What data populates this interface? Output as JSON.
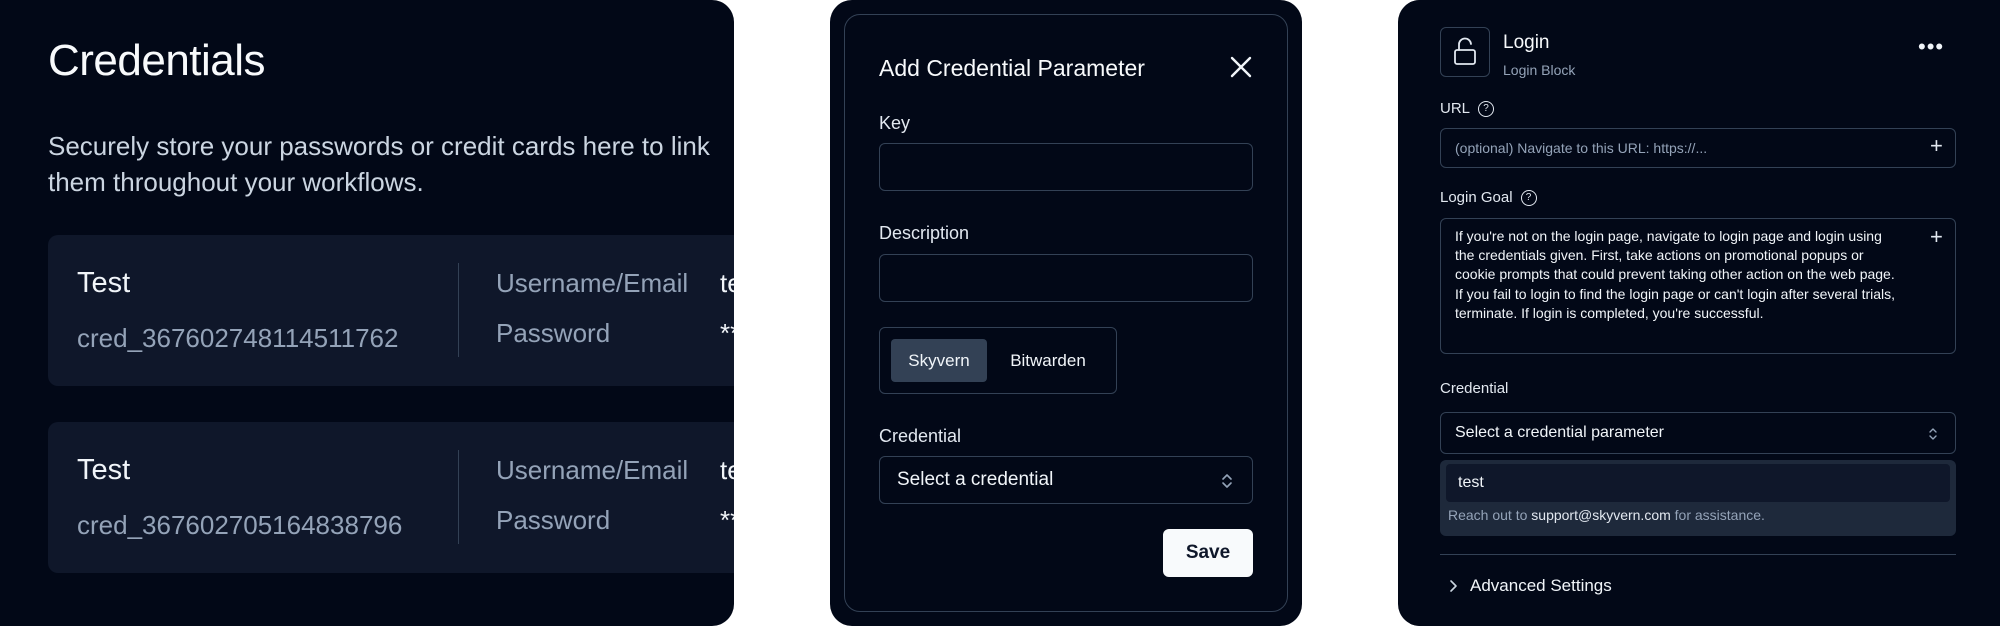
{
  "credentials_page": {
    "title": "Credentials",
    "subtitle": "Securely store your passwords or credit cards here to link them throughout your workflows.",
    "cards": [
      {
        "name": "Test",
        "id": "cred_367602748114511762",
        "username_label": "Username/Email",
        "username_value": "te",
        "password_label": "Password",
        "password_value": "**"
      },
      {
        "name": "Test",
        "id": "cred_367602705164838796",
        "username_label": "Username/Email",
        "username_value": "te",
        "password_label": "Password",
        "password_value": "**"
      }
    ]
  },
  "modal": {
    "title": "Add Credential Parameter",
    "key_label": "Key",
    "key_value": "",
    "description_label": "Description",
    "description_value": "",
    "tabs": [
      "Skyvern",
      "Bitwarden"
    ],
    "active_tab": "Skyvern",
    "credential_label": "Credential",
    "credential_select": "Select a credential",
    "save_label": "Save"
  },
  "login_block": {
    "title": "Login",
    "subtitle": "Login Block",
    "url_label": "URL",
    "url_placeholder": "(optional) Navigate to this URL: https://...",
    "goal_label": "Login Goal",
    "goal_text": "If you're not on the login page, navigate to login page and login using the credentials given. First, take actions on promotional popups or cookie prompts that could prevent taking other action on the web page. If you fail to login to find the login page or can't login after several trials, terminate. If login is completed, you're successful.",
    "credential_label": "Credential",
    "credential_select": "Select a credential parameter",
    "dropdown_option": "test",
    "help_prefix": "Reach out to",
    "help_email": "support@skyvern.com",
    "help_suffix": "for assistance.",
    "advanced_label": "Advanced Settings"
  },
  "colors": {
    "background": "#020817",
    "card": "#0f172a",
    "border": "#334155",
    "text": "#f8fafc",
    "muted": "#94a3b8"
  }
}
